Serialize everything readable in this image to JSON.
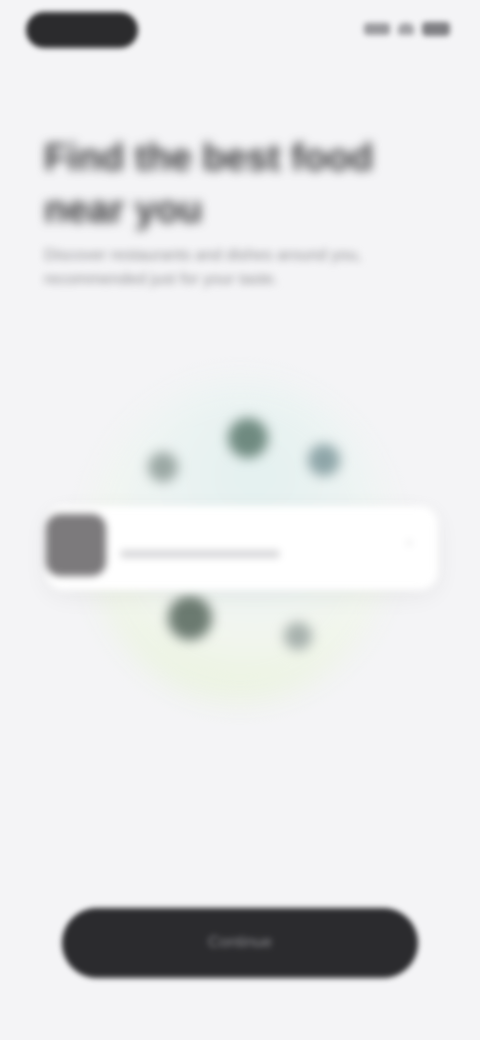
{
  "status_bar": {
    "time_pill": "",
    "icons": [
      "signal-icon",
      "wifi-icon",
      "battery-icon"
    ]
  },
  "header": {
    "title": "Find the best food near you",
    "subtitle": "Discover restaurants and dishes around you, recommended just for your taste."
  },
  "illustration": {
    "card": {
      "title": "",
      "chevron": "›"
    }
  },
  "cta": {
    "label": "Continue"
  },
  "colors": {
    "background": "#f4f4f6",
    "button": "#2b2b2e",
    "card": "#ffffff"
  }
}
